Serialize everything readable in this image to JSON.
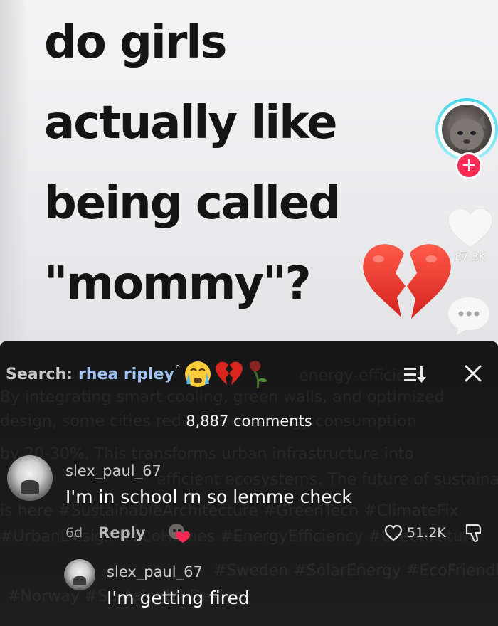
{
  "video": {
    "headline_lines": [
      "do girls",
      "actually like",
      "being called",
      "\"mommy\"?"
    ],
    "like_count": "87.3K"
  },
  "comments_panel": {
    "search_label": "Search:",
    "search_term": "rhea ripley",
    "search_suffix": "°",
    "count_label": "8,887 comments",
    "comments": [
      {
        "username": "slex_paul_67",
        "text": "I'm in school rn so lemme check",
        "time": "6d",
        "reply_label": "Reply",
        "likes": "51.2K"
      },
      {
        "username": "slex_paul_67",
        "text": "I'm getting fired"
      }
    ],
    "background_ghost_text": [
      "By integrating smart cooling, green walls, and optimized",
      "design, some cities reduce their energy consumption",
      "by 20-30%. This transforms urban infrastructure into",
      "efficient ecosystems. The future of sustainable housing",
      "is here #SustainableArchitecture #GreenTech #ClimateFix",
      "#UrbanDesign #EcoHomes #EnergyEfficiency #GreenFuture",
      "#Sweden #SolarEnergy #EcoFriendly",
      "#Norway #SustainableDesign"
    ]
  },
  "colors": {
    "headline": "#141414",
    "follow_red": "#fe2c55",
    "search_term": "#9fc2f0",
    "sheet_bg": "#161616"
  },
  "icons": [
    "broken-heart-icon",
    "avatar-ring",
    "plus-icon",
    "heart-icon",
    "comment-bubble-icon",
    "sort-icon",
    "close-icon",
    "crying-face-emoji",
    "broken-heart-emoji",
    "wilted-rose-emoji",
    "heart-outline-icon",
    "dislike-icon"
  ]
}
